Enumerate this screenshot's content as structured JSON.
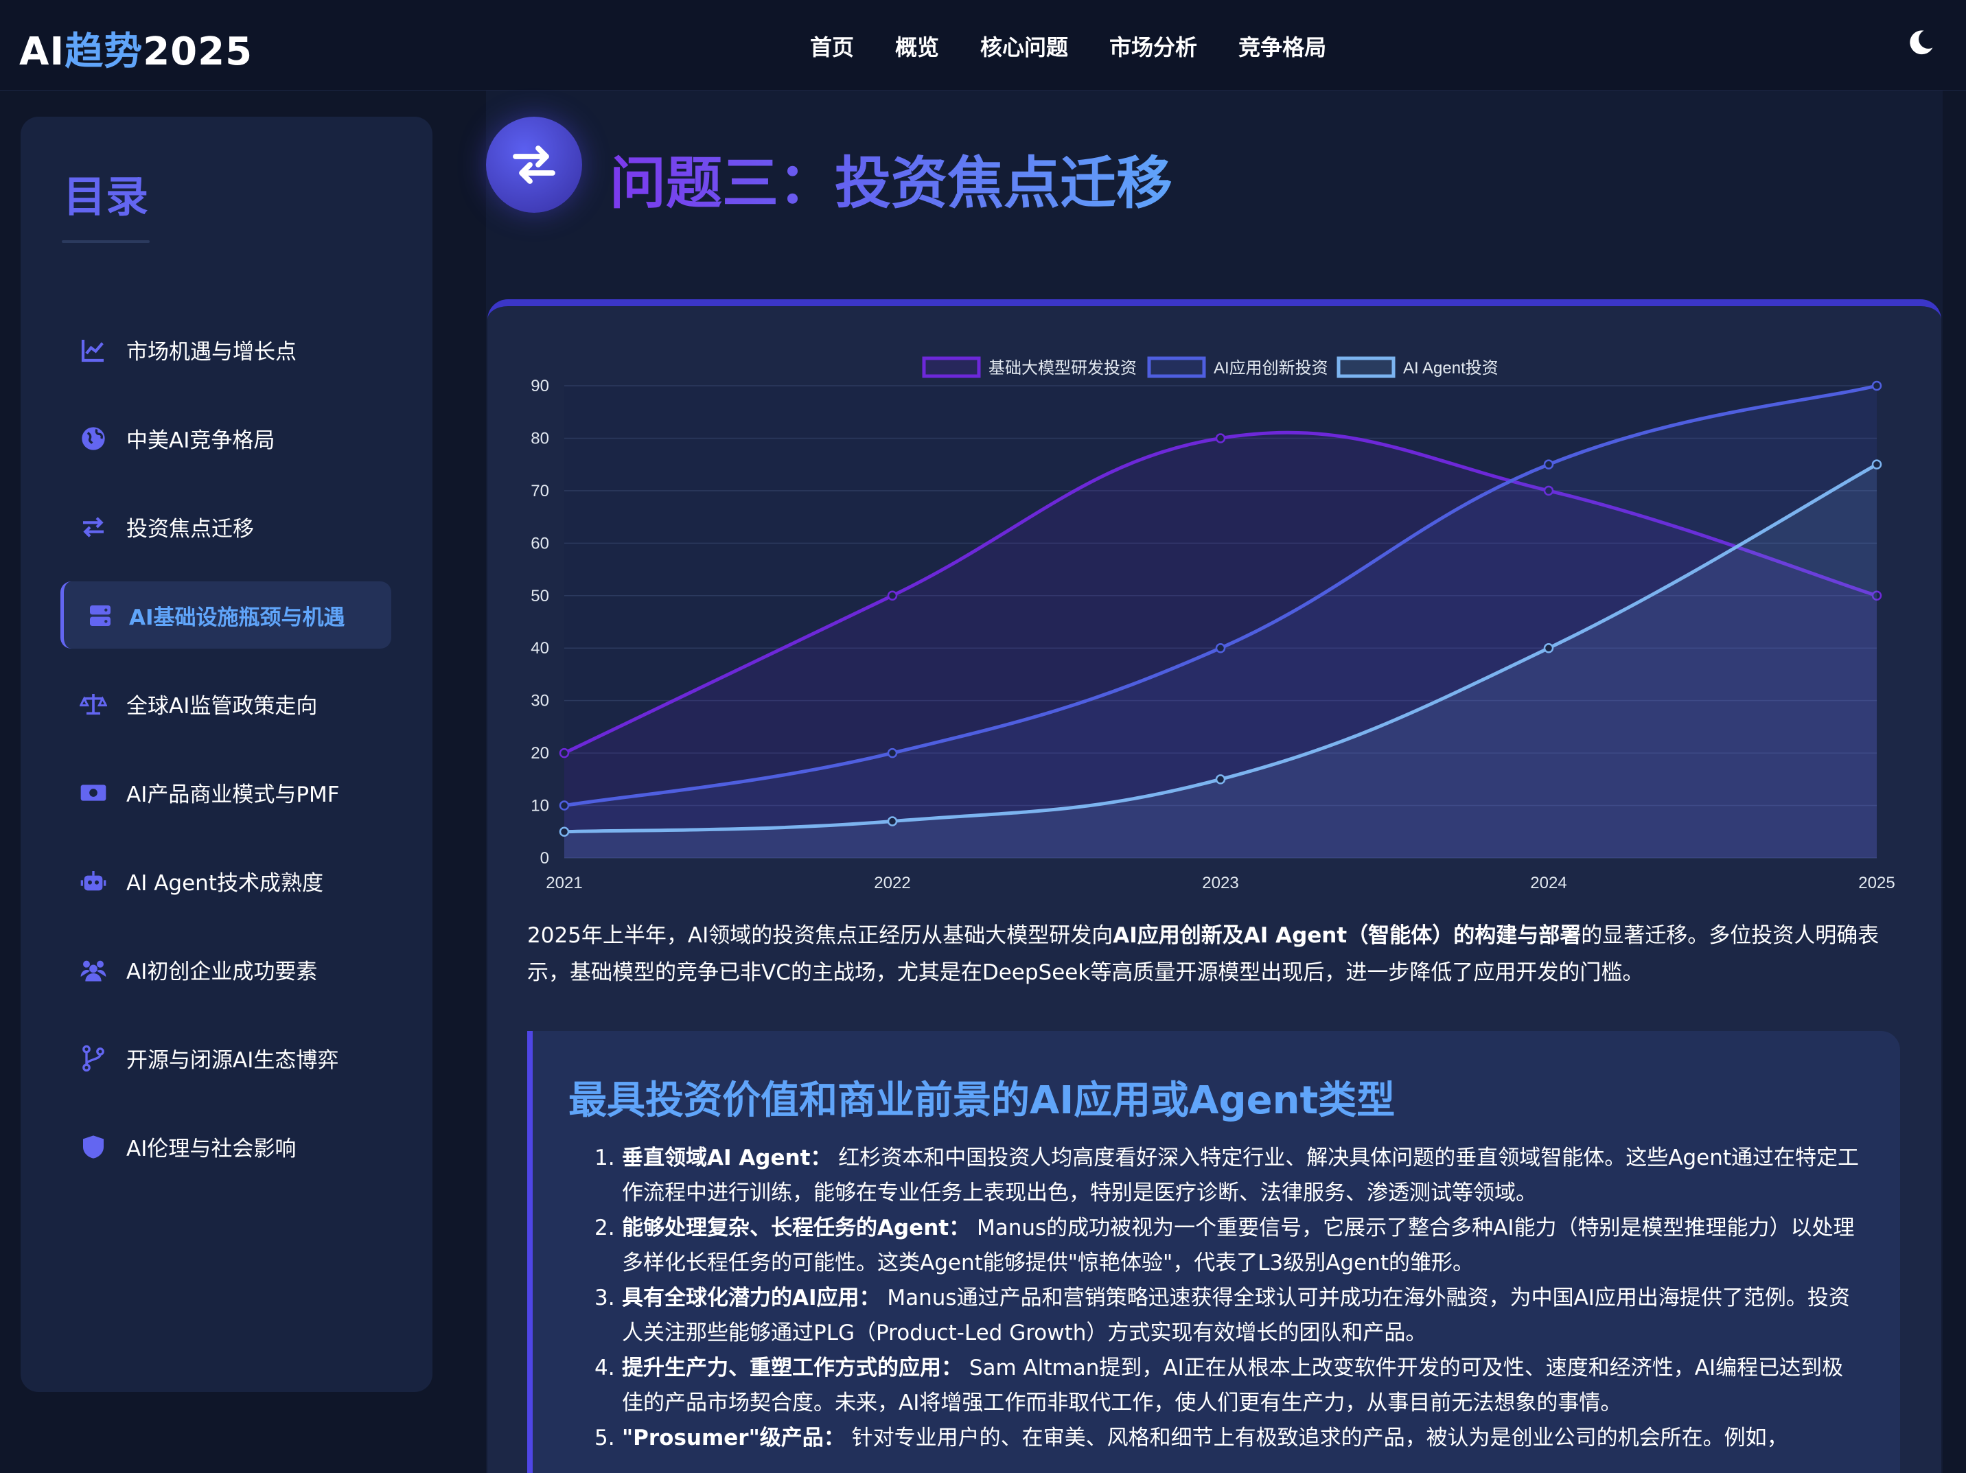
{
  "header": {
    "logo_prefix": "AI",
    "logo_accent": "趋势",
    "logo_suffix": "2025",
    "nav": [
      "首页",
      "概览",
      "核心问题",
      "市场分析",
      "竞争格局"
    ],
    "theme_icon": "moon-icon"
  },
  "sidebar": {
    "title": "目录",
    "items": [
      {
        "label": "市场机遇与增长点",
        "icon": "chart-line-icon"
      },
      {
        "label": "中美AI竞争格局",
        "icon": "globe-icon"
      },
      {
        "label": "投资焦点迁移",
        "icon": "exchange-icon"
      },
      {
        "label": "AI基础设施瓶颈与机遇",
        "icon": "server-icon",
        "active": true
      },
      {
        "label": "全球AI监管政策走向",
        "icon": "scale-icon"
      },
      {
        "label": "AI产品商业模式与PMF",
        "icon": "money-icon"
      },
      {
        "label": "AI Agent技术成熟度",
        "icon": "robot-icon"
      },
      {
        "label": "AI初创企业成功要素",
        "icon": "users-icon"
      },
      {
        "label": "开源与闭源AI生态博弈",
        "icon": "code-branch-icon"
      },
      {
        "label": "AI伦理与社会影响",
        "icon": "shield-icon"
      }
    ]
  },
  "section": {
    "title": "问题三：投资焦点迁移",
    "icon": "exchange-icon"
  },
  "chart_data": {
    "type": "line",
    "x": [
      "2021",
      "2022",
      "2023",
      "2024",
      "2025"
    ],
    "ylim": [
      0,
      90
    ],
    "yticks": [
      0,
      10,
      20,
      30,
      40,
      50,
      60,
      70,
      80,
      90
    ],
    "legend_position": "top-center",
    "grid": true,
    "series": [
      {
        "name": "基础大模型研发投资",
        "values": [
          20,
          50,
          80,
          70,
          50
        ],
        "color": "#6d28d9"
      },
      {
        "name": "AI应用创新投资",
        "values": [
          10,
          20,
          40,
          75,
          90
        ],
        "color": "#4f5fe0"
      },
      {
        "name": "AI Agent投资",
        "values": [
          5,
          7,
          15,
          40,
          75
        ],
        "color": "#7cb4f0"
      }
    ]
  },
  "intro": {
    "p1": "2025年上半年，AI领域的投资焦点正经历从基础大模型研发向",
    "p1_bold": "AI应用创新及AI Agent（智能体）的构建与部署",
    "p2": "的显著迁移。多位投资人明确表示，基础模型的竞争已非VC的主战场，尤其是在DeepSeek等高质量开源模型出现后，进一步降低了应用开发的门槛。"
  },
  "callout": {
    "title": "最具投资价值和商业前景的AI应用或Agent类型",
    "items": [
      {
        "num": "1.",
        "bold": "垂直领域AI Agent：",
        "text": " 红杉资本和中国投资人均高度看好深入特定行业、解决具体问题的垂直领域智能体。这些Agent通过在特定工作流程中进行训练，能够在专业任务上表现出色，特别是医疗诊断、法律服务、渗透测试等领域。"
      },
      {
        "num": "2.",
        "bold": "能够处理复杂、长程任务的Agent：",
        "text": " Manus的成功被视为一个重要信号，它展示了整合多种AI能力（特别是模型推理能力）以处理多样化长程任务的可能性。这类Agent能够提供\"惊艳体验\"，代表了L3级别Agent的雏形。"
      },
      {
        "num": "3.",
        "bold": "具有全球化潜力的AI应用：",
        "text": " Manus通过产品和营销策略迅速获得全球认可并成功在海外融资，为中国AI应用出海提供了范例。投资人关注那些能够通过PLG（Product-Led Growth）方式实现有效增长的团队和产品。"
      },
      {
        "num": "4.",
        "bold": "提升生产力、重塑工作方式的应用：",
        "text": " Sam Altman提到，AI正在从根本上改变软件开发的可及性、速度和经济性，AI编程已达到极佳的产品市场契合度。未来，AI将增强工作而非取代工作，使人们更有生产力，从事目前无法想象的事情。"
      },
      {
        "num": "5.",
        "bold": "\"Prosumer\"级产品：",
        "text": " 针对专业用户的、在审美、风格和细节上有极致追求的产品，被认为是创业公司的机会所在。例如，"
      }
    ]
  }
}
